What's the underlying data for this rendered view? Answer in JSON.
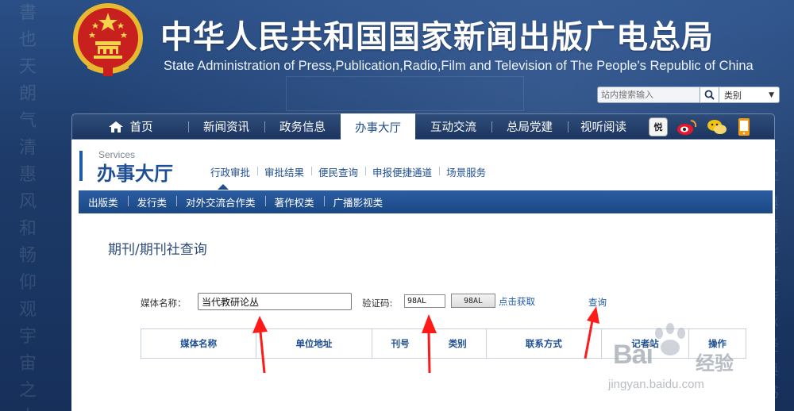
{
  "header": {
    "title_cn": "中华人民共和国国家新闻出版广电总局",
    "title_en": "State Administration of Press,Publication,Radio,Film and Television of The People's Republic of China",
    "emblem_icon": "national-emblem-icon"
  },
  "search": {
    "placeholder": "站内搜索输入",
    "type_label": "类别"
  },
  "mainnav": {
    "items": [
      {
        "label": "首页"
      },
      {
        "label": "新闻资讯"
      },
      {
        "label": "政务信息"
      },
      {
        "label": "办事大厅"
      },
      {
        "label": "互动交流"
      },
      {
        "label": "总局党建"
      },
      {
        "label": "视听阅读"
      }
    ],
    "active_index": 3
  },
  "services": {
    "en": "Services",
    "cn": "办事大厅",
    "subnav": [
      {
        "label": "行政审批"
      },
      {
        "label": "审批结果"
      },
      {
        "label": "便民查询"
      },
      {
        "label": "申报便捷通道"
      },
      {
        "label": "场景服务"
      }
    ],
    "categories": [
      {
        "label": "出版类"
      },
      {
        "label": "发行类"
      },
      {
        "label": "对外交流合作类"
      },
      {
        "label": "著作权类"
      },
      {
        "label": "广播影视类"
      }
    ]
  },
  "page": {
    "title": "期刊/期刊社查询"
  },
  "form": {
    "media_label": "媒体名称：",
    "media_value": "当代教研论丛",
    "code_label": "验证码:",
    "code_value": "98AL",
    "code_image_text": "98AL",
    "code_refresh": "点击获取",
    "query_link": "查询"
  },
  "table": {
    "headers": [
      "媒体名称",
      "单位地址",
      "刊号",
      "类别",
      "联系方式",
      "记者站",
      "操作"
    ]
  },
  "watermark": {
    "brand": "Bai",
    "brand_cn": "经验",
    "url": "jingyan.baidu.com"
  },
  "colors": {
    "accent": "#1f4f93",
    "nav_bg": "#1c3560",
    "annotation": "#ff1a1a"
  }
}
